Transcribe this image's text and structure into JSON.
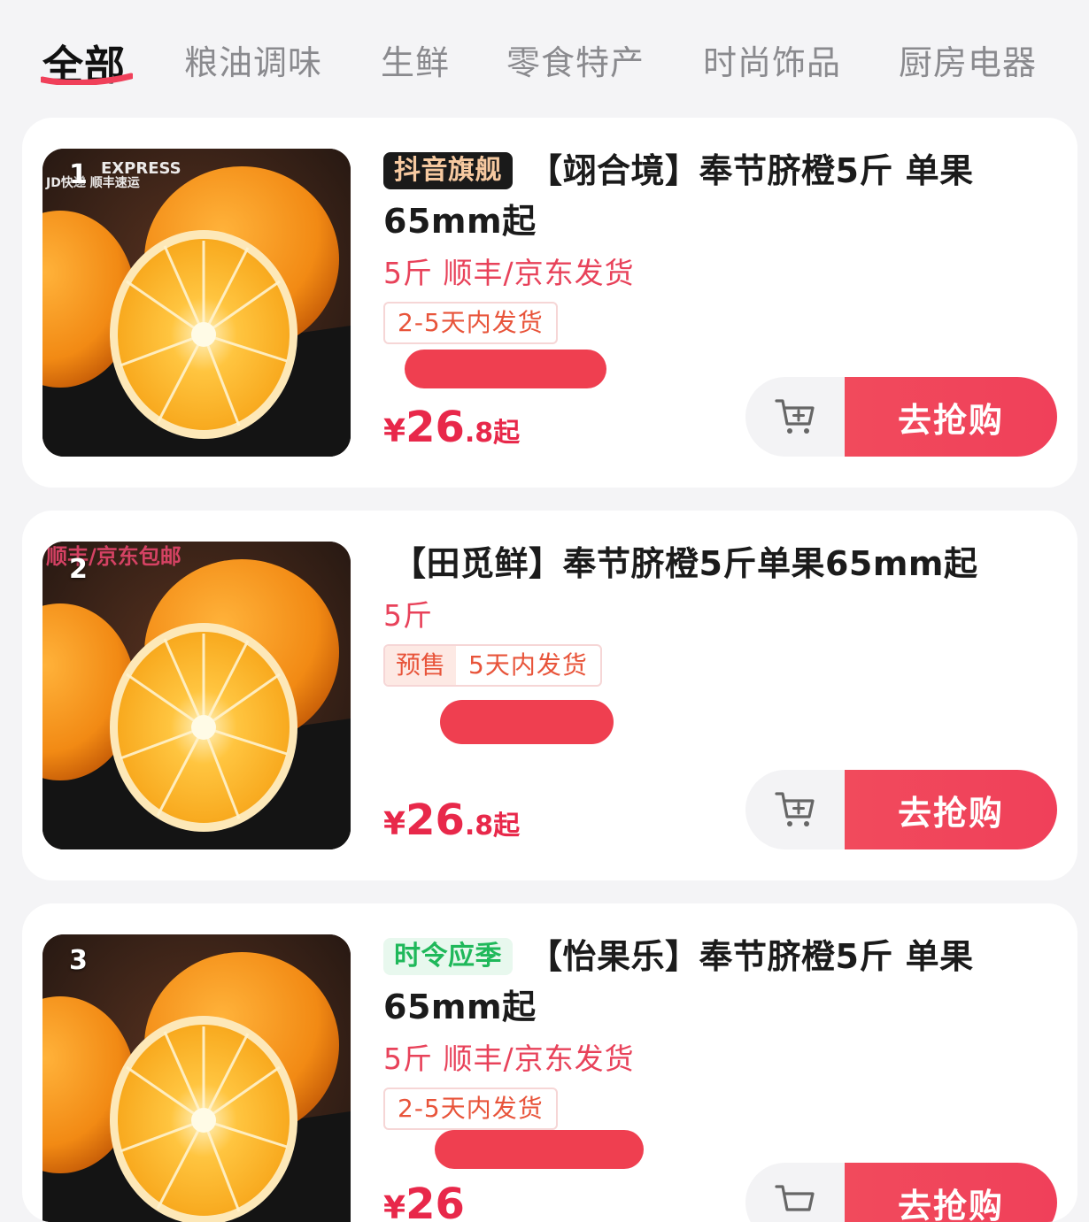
{
  "tabs": [
    {
      "label": "全部",
      "active": true
    },
    {
      "label": "粮油调味"
    },
    {
      "label": "生鲜"
    },
    {
      "label": "零食特产"
    },
    {
      "label": "时尚饰品"
    },
    {
      "label": "厨房电器"
    }
  ],
  "accent_color": "#f0405a",
  "products": [
    {
      "rank": "1",
      "thumb_text_1": "EXPRESS",
      "thumb_text_2": "JD快递  顺丰速运",
      "badge": "抖音旗舰",
      "title": "【翊合境】奉节脐橙5斤 单果65mm起",
      "spec": "5斤 顺丰/京东发货",
      "ship_prefix": "",
      "ship_text": "2-5天内发货",
      "price_currency": "¥",
      "price_int": "26",
      "price_dec": ".8",
      "price_suffix": "起",
      "buy_label": "去抢购",
      "cart_icon": "add-to-cart-icon"
    },
    {
      "rank": "2",
      "thumb_text_1": "顺丰/京东包邮",
      "badge": "",
      "title": "【田觅鲜】奉节脐橙5斤单果65mm起",
      "spec": "5斤",
      "ship_prefix": "预售",
      "ship_text": "5天内发货",
      "price_currency": "¥",
      "price_int": "26",
      "price_dec": ".8",
      "price_suffix": "起",
      "buy_label": "去抢购",
      "cart_icon": "add-to-cart-icon"
    },
    {
      "rank": "3",
      "badge": "时令应季",
      "title": "【怡果乐】奉节脐橙5斤 单果65mm起",
      "spec": "5斤 顺丰/京东发货",
      "ship_prefix": "",
      "ship_text": "2-5天内发货",
      "price_currency": "¥",
      "price_int": "26",
      "buy_label": "去抢购",
      "cart_icon": "add-to-cart-icon"
    }
  ]
}
